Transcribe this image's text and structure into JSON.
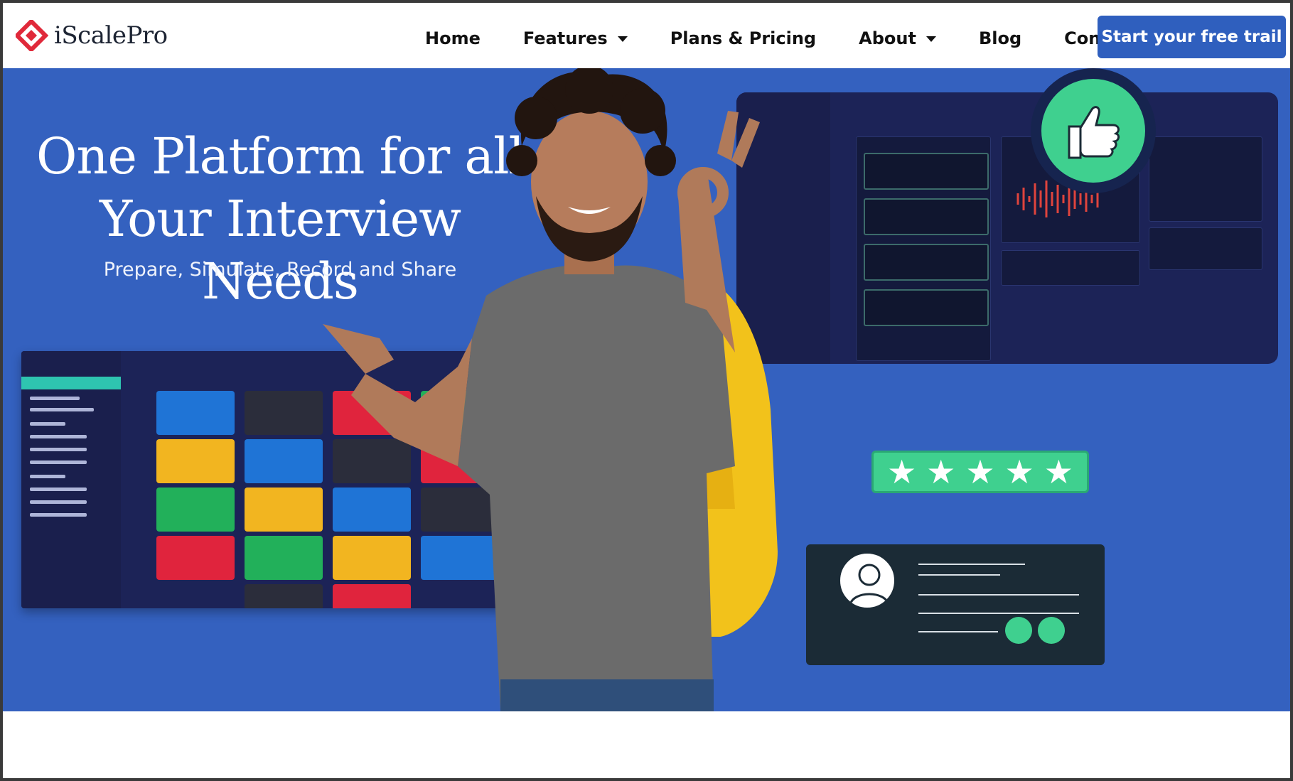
{
  "brand": {
    "name": "iScalePro",
    "logo_icon": "diamond-logo-icon",
    "accent": "#e0293a"
  },
  "nav": {
    "items": [
      {
        "label": "Home",
        "has_dropdown": false
      },
      {
        "label": "Features",
        "has_dropdown": true
      },
      {
        "label": "Plans & Pricing",
        "has_dropdown": false
      },
      {
        "label": "About",
        "has_dropdown": true
      },
      {
        "label": "Blog",
        "has_dropdown": false
      },
      {
        "label": "Contact",
        "has_dropdown": false
      }
    ],
    "cta_label": "Start your free trail",
    "cta_color": "#2f5fbe"
  },
  "hero": {
    "background": "#3461bf",
    "headline_line1": "One Platform for all",
    "headline_line2": "Your Interview Needs",
    "subheadline": "Prepare, Simulate, Record and Share",
    "rating_stars": 5,
    "rating_color": "#3fd08f"
  }
}
